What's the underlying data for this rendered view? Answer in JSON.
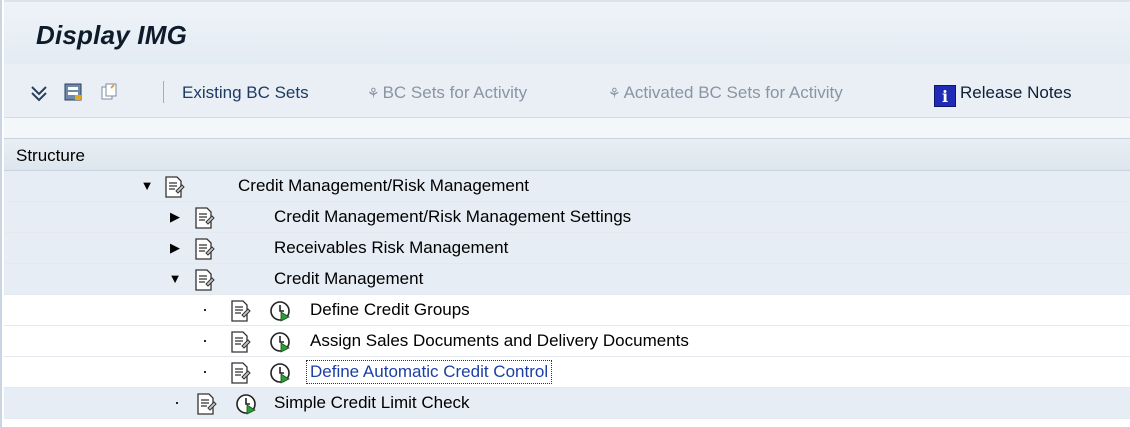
{
  "window": {
    "title": "Display IMG"
  },
  "toolbar": {
    "icons": [
      "expand-icon",
      "find-icon",
      "copy-icon"
    ],
    "buttons": [
      {
        "label": "Existing BC Sets",
        "enabled": true
      },
      {
        "label": "BC Sets for Activity",
        "enabled": false,
        "icon": "bc-set-icon"
      },
      {
        "label": "Activated BC Sets for Activity",
        "enabled": false,
        "icon": "bc-set-icon"
      },
      {
        "label": "Release Notes",
        "enabled": true,
        "icon": "info-icon"
      }
    ]
  },
  "tree": {
    "header": "Structure",
    "rows": [
      {
        "label": "Credit Management/Risk Management",
        "state": "expanded",
        "level": 0,
        "executable": false
      },
      {
        "label": "Credit Management/Risk Management Settings",
        "state": "collapsed",
        "level": 1,
        "executable": false
      },
      {
        "label": "Receivables Risk Management",
        "state": "collapsed",
        "level": 1,
        "executable": false
      },
      {
        "label": "Credit Management",
        "state": "expanded",
        "level": 1,
        "executable": false
      },
      {
        "label": "Define Credit Groups",
        "state": "leaf",
        "level": 2,
        "executable": true
      },
      {
        "label": "Assign Sales Documents and Delivery Documents",
        "state": "leaf",
        "level": 2,
        "executable": true
      },
      {
        "label": "Define Automatic Credit Control",
        "state": "leaf",
        "level": 2,
        "executable": true,
        "focused": true
      },
      {
        "label": "Simple Credit Limit Check",
        "state": "leaf",
        "level": 1,
        "executable": true
      }
    ]
  },
  "colors": {
    "accent": "#1d3b63",
    "highlight_row": "#e6edf4",
    "focused_text": "#1b3fa6"
  }
}
